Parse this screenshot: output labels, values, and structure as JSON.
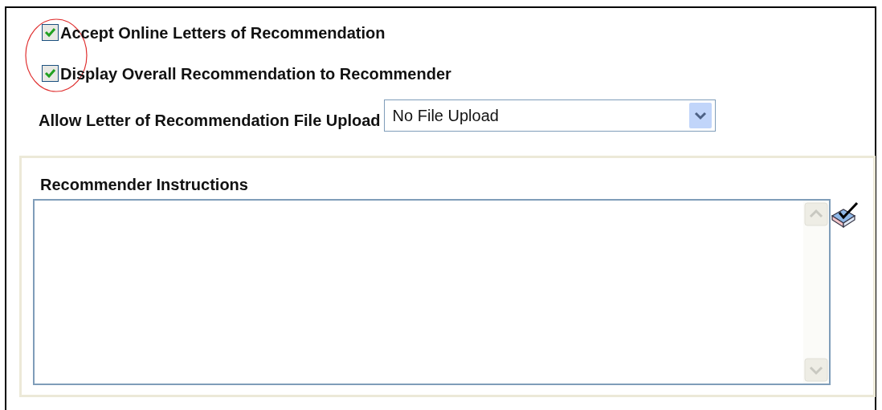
{
  "options": [
    {
      "label": "Accept Online Letters of Recommendation",
      "checked": true
    },
    {
      "label": "Display Overall Recommendation to Recommender",
      "checked": true
    }
  ],
  "file_upload": {
    "label": "Allow Letter of Recommendation File Upload",
    "value": "No File Upload"
  },
  "instructions": {
    "title": "Recommender Instructions"
  }
}
